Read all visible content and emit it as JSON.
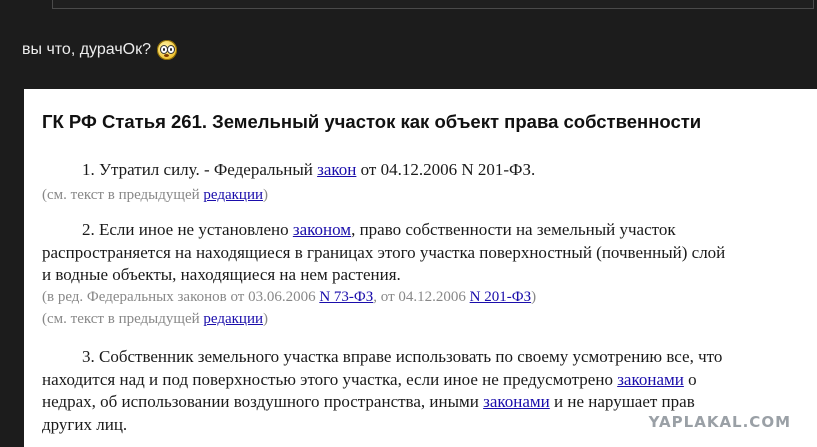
{
  "post": {
    "text": "вы что, дурачОк?",
    "emoji": "surprised-smiley-icon"
  },
  "document": {
    "title": "ГК РФ Статья 261. Земельный участок как объект права собственности",
    "p1": {
      "text": "1. Утратил силу. - Федеральный ",
      "link": "закон",
      "tail": " от 04.12.2006 N 201-ФЗ."
    },
    "n1": {
      "text": "(см. текст в предыдущей ",
      "link": "редакции",
      "tail": ")"
    },
    "p2": {
      "line1_pre": "2. Если иное не установлено ",
      "line1_link": "законом",
      "line1_post": ", право собственности на земельный участок",
      "line2": "распространяется на находящиеся в границах этого участка поверхностный (почвенный) слой",
      "line3": "и водные объекты, находящиеся на нем растения."
    },
    "n2": {
      "pre": "(в ред. Федеральных законов от 03.06.2006 ",
      "link1": "N 73-ФЗ",
      "mid": ", от 04.12.2006 ",
      "link2": "N 201-ФЗ",
      "tail": ")"
    },
    "n3": {
      "text": "(см. текст в предыдущей ",
      "link": "редакции",
      "tail": ")"
    },
    "p3": {
      "line1": "3. Собственник земельного участка вправе использовать по своему усмотрению все, что",
      "line2_pre": "находится над и под поверхностью этого участка, если иное не предусмотрено ",
      "line2_link": "законами",
      "line2_post": " о",
      "line3_pre": "недрах, об использовании воздушного пространства, иными ",
      "line3_link": "законами",
      "line3_post": " и не нарушает прав",
      "line4": "других лиц."
    }
  },
  "watermark": "YAPLAKAL.COM",
  "colors": {
    "background": "#1c1c1c",
    "link": "#1a0dab",
    "note": "#888888"
  }
}
